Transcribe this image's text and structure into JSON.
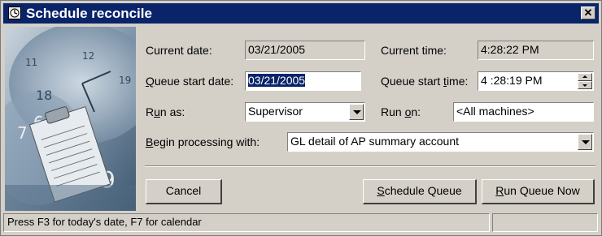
{
  "window": {
    "title": "Schedule reconcile",
    "close_glyph": "✕",
    "app_icon": "app-icon"
  },
  "current_date": {
    "label": "Current date:",
    "value": "03/21/2005"
  },
  "current_time": {
    "label": "Current time:",
    "value": "4:28:22 PM"
  },
  "queue_start_date": {
    "label_pre": "",
    "label_mn": "Q",
    "label_post": "ueue start date:",
    "value": "03/21/2005"
  },
  "queue_start_time": {
    "label_pre": "Queue start ",
    "label_mn": "t",
    "label_post": "ime:",
    "value": "4 :28:19 PM"
  },
  "run_as": {
    "label_pre": "R",
    "label_mn": "u",
    "label_post": "n as:",
    "value": "Supervisor"
  },
  "run_on": {
    "label_pre": "Run ",
    "label_mn": "o",
    "label_post": "n:",
    "value": "<All machines>"
  },
  "begin_processing": {
    "label_pre": "",
    "label_mn": "B",
    "label_post": "egin processing with:",
    "value": "GL detail of AP summary account"
  },
  "buttons": {
    "cancel": "Cancel",
    "schedule_pre": "",
    "schedule_mn": "S",
    "schedule_post": "chedule Queue",
    "run_pre": "",
    "run_mn": "R",
    "run_post": "un Queue Now"
  },
  "status_bar": {
    "text": "Press F3 for today's date, F7 for calendar",
    "secondary": ""
  },
  "colors": {
    "title_bar": "#0a246a",
    "face": "#d4d0c8",
    "selection": "#0a246a"
  }
}
